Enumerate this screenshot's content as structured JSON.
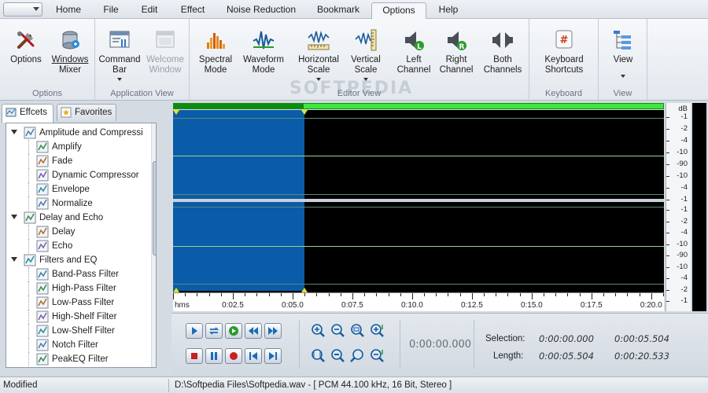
{
  "menu": {
    "tabs": [
      {
        "label": "Home",
        "active": false
      },
      {
        "label": "File",
        "active": false
      },
      {
        "label": "Edit",
        "active": false
      },
      {
        "label": "Effect",
        "active": false
      },
      {
        "label": "Noise Reduction",
        "active": false
      },
      {
        "label": "Bookmark",
        "active": false
      },
      {
        "label": "Options",
        "active": true
      },
      {
        "label": "Help",
        "active": false
      }
    ]
  },
  "ribbon": {
    "groups": [
      {
        "label": "Options",
        "buttons": [
          {
            "label_1": "Options",
            "label_2": "",
            "icon": "tools-icon",
            "enabled": true
          },
          {
            "label_1": "Windows",
            "label_2": "Mixer",
            "icon": "mixer-icon",
            "enabled": true
          }
        ]
      },
      {
        "label": "Application View",
        "buttons": [
          {
            "label_1": "Command",
            "label_2": "Bar",
            "icon": "command-bar-icon",
            "enabled": true,
            "dropdown": true
          },
          {
            "label_1": "Welcome",
            "label_2": "Window",
            "icon": "welcome-window-icon",
            "enabled": false
          }
        ]
      },
      {
        "label": "Editor View",
        "buttons": [
          {
            "label_1": "Spectral",
            "label_2": "Mode",
            "icon": "spectral-icon",
            "enabled": true
          },
          {
            "label_1": "Waveform",
            "label_2": "Mode",
            "icon": "waveform-icon",
            "enabled": true
          },
          {
            "label_1": "Horizontal",
            "label_2": "Scale",
            "icon": "horizontal-scale-icon",
            "enabled": true,
            "dropdown": true
          },
          {
            "label_1": "Vertical",
            "label_2": "Scale",
            "icon": "vertical-scale-icon",
            "enabled": true,
            "dropdown": true
          },
          {
            "label_1": "Left",
            "label_2": "Channel",
            "icon": "left-channel-icon",
            "enabled": true
          },
          {
            "label_1": "Right",
            "label_2": "Channel",
            "icon": "right-channel-icon",
            "enabled": true
          },
          {
            "label_1": "Both",
            "label_2": "Channels",
            "icon": "both-channels-icon",
            "enabled": true
          }
        ]
      },
      {
        "label": "Keyboard",
        "buttons": [
          {
            "label_1": "Keyboard",
            "label_2": "Shortcuts",
            "icon": "keyboard-shortcuts-icon",
            "enabled": true
          }
        ]
      },
      {
        "label": "View",
        "buttons": [
          {
            "label_1": "View",
            "label_2": "",
            "icon": "view-tree-icon",
            "enabled": true,
            "dropdown": true
          }
        ]
      }
    ],
    "watermark": "SOFTPEDIA"
  },
  "panel": {
    "tabs": [
      {
        "label": "Effcets",
        "active": true,
        "icon": "effects-tab-icon"
      },
      {
        "label": "Favorites",
        "active": false,
        "icon": "favorites-star-icon"
      }
    ],
    "tree": [
      {
        "level": 0,
        "label": "Amplitude and Compressi",
        "icon": "amplitude-icon",
        "expanded": true
      },
      {
        "level": 1,
        "label": "Amplify",
        "icon": "amplify-icon"
      },
      {
        "level": 1,
        "label": "Fade",
        "icon": "fade-icon"
      },
      {
        "level": 1,
        "label": "Dynamic Compressor",
        "icon": "compressor-icon"
      },
      {
        "level": 1,
        "label": "Envelope",
        "icon": "envelope-icon"
      },
      {
        "level": 1,
        "label": "Normalize",
        "icon": "normalize-icon"
      },
      {
        "level": 0,
        "label": "Delay and Echo",
        "icon": "delay-echo-icon",
        "expanded": true
      },
      {
        "level": 1,
        "label": "Delay",
        "icon": "delay-icon"
      },
      {
        "level": 1,
        "label": "Echo",
        "icon": "echo-icon"
      },
      {
        "level": 0,
        "label": "Filters and EQ",
        "icon": "filters-icon",
        "expanded": true
      },
      {
        "level": 1,
        "label": "Band-Pass Filter",
        "icon": "band-pass-icon"
      },
      {
        "level": 1,
        "label": "High-Pass Filter",
        "icon": "high-pass-icon"
      },
      {
        "level": 1,
        "label": "Low-Pass Filter",
        "icon": "low-pass-icon"
      },
      {
        "level": 1,
        "label": "High-Shelf Filter",
        "icon": "high-shelf-icon"
      },
      {
        "level": 1,
        "label": "Low-Shelf Filter",
        "icon": "low-shelf-icon"
      },
      {
        "level": 1,
        "label": "Notch Filter",
        "icon": "notch-icon"
      },
      {
        "level": 1,
        "label": "PeakEQ Filter",
        "icon": "peakeq-icon"
      }
    ]
  },
  "editor": {
    "ruler": {
      "unit": "hms",
      "labels": [
        "0:02.5",
        "0:05.0",
        "0:07.5",
        "0:10.0",
        "0:12.5",
        "0:15.0",
        "0:17.5",
        "0:20.0"
      ]
    },
    "db_scale": {
      "unit": "dB",
      "top_channel": [
        "-1",
        "-2",
        "-4",
        "-10",
        "-90",
        "-10",
        "-4",
        "-1"
      ],
      "bottom_channel": [
        "-1",
        "-2",
        "-4",
        "-10",
        "-90",
        "-10",
        "-4",
        "-2",
        "-1"
      ]
    },
    "selection_fraction_start": 0.0,
    "selection_fraction_end": 0.268,
    "colors": {
      "selection": "#0a5ca8",
      "background": "#000000",
      "overview": "#3ce83c",
      "centerline": "#8fd88f"
    }
  },
  "transport": {
    "buttons_row1": [
      "play-icon",
      "loop-icon",
      "play-looped-icon",
      "rewind-icon",
      "fast-forward-icon"
    ],
    "buttons_row2": [
      "stop-icon",
      "pause-icon",
      "record-icon",
      "go-to-start-icon",
      "go-to-end-icon"
    ],
    "zoom_row1": [
      "zoom-in-icon",
      "zoom-out-icon",
      "zoom-selection-icon",
      "zoom-in-vertical-icon"
    ],
    "zoom_row2": [
      "zoom-full-icon",
      "zoom-out-full-icon",
      "zoom-left-icon",
      "zoom-out-vertical-icon"
    ],
    "timecode": "0:00:00.000",
    "selection_label": "Selection:",
    "selection_start": "0:00:00.000",
    "selection_end": "0:00:05.504",
    "length_label": "Length:",
    "length_selection": "0:00:05.504",
    "length_total": "0:00:20.533"
  },
  "status": {
    "state": "Modified",
    "file_info": "D:\\Softpedia Files\\Softpedia.wav - [ PCM 44.100 kHz, 16 Bit, Stereo ]"
  }
}
